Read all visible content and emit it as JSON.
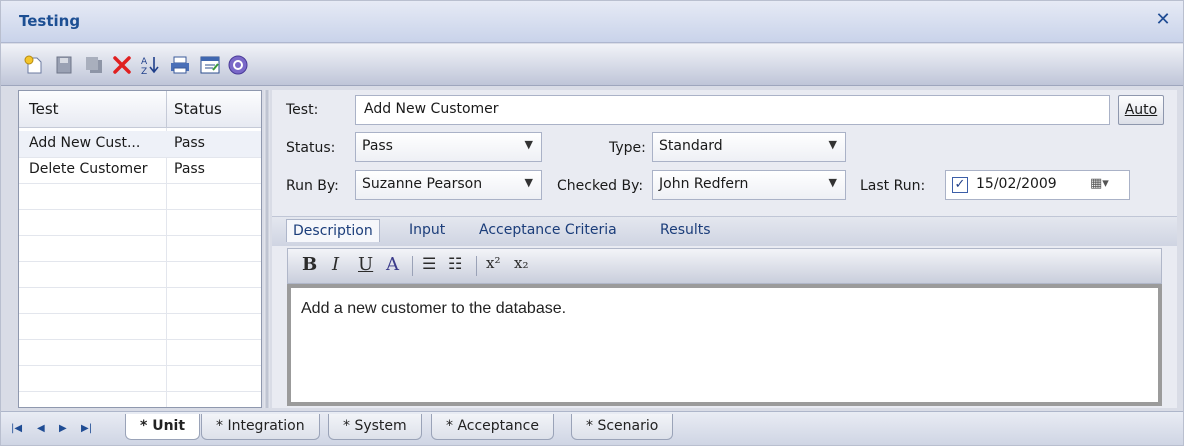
{
  "window": {
    "title": "Testing",
    "close_label": "✕"
  },
  "toolbar": {
    "buttons": [
      {
        "icon": "new-icon"
      },
      {
        "icon": "save-icon"
      },
      {
        "icon": "copy-icon"
      },
      {
        "icon": "delete-icon"
      },
      {
        "icon": "sort-icon"
      },
      {
        "icon": "print-icon"
      },
      {
        "icon": "properties-icon"
      },
      {
        "icon": "help-icon"
      }
    ]
  },
  "list": {
    "columns": [
      "Test",
      "Status"
    ],
    "rows": [
      {
        "test": "Add New Cust...",
        "status": "Pass"
      },
      {
        "test": "Delete Customer",
        "status": "Pass"
      }
    ]
  },
  "form": {
    "test_label": "Test:",
    "test_value": "Add New Customer",
    "auto_label": "Auto",
    "status_label": "Status:",
    "status_value": "Pass",
    "type_label": "Type:",
    "type_value": "Standard",
    "runby_label": "Run By:",
    "runby_value": "Suzanne Pearson",
    "checkedby_label": "Checked By:",
    "checkedby_value": "John Redfern",
    "lastrun_label": "Last Run:",
    "lastrun_value": "15/02/2009",
    "lastrun_checked": "✓"
  },
  "detail_tabs": [
    "Description",
    "Input",
    "Acceptance Criteria",
    "Results"
  ],
  "format_toolbar": {
    "bold": "B",
    "italic": "I",
    "underline": "U",
    "font_color": "A",
    "bullets": "☰",
    "numbering": "☷",
    "superscript": "x²",
    "subscript": "x₂"
  },
  "description_text": "Add a new customer to the database.",
  "bottom_tabs": [
    "* Unit",
    "* Integration",
    "* System",
    "* Acceptance",
    "* Scenario"
  ],
  "nav_buttons": [
    "|◀",
    "◀",
    "▶",
    "▶|"
  ]
}
